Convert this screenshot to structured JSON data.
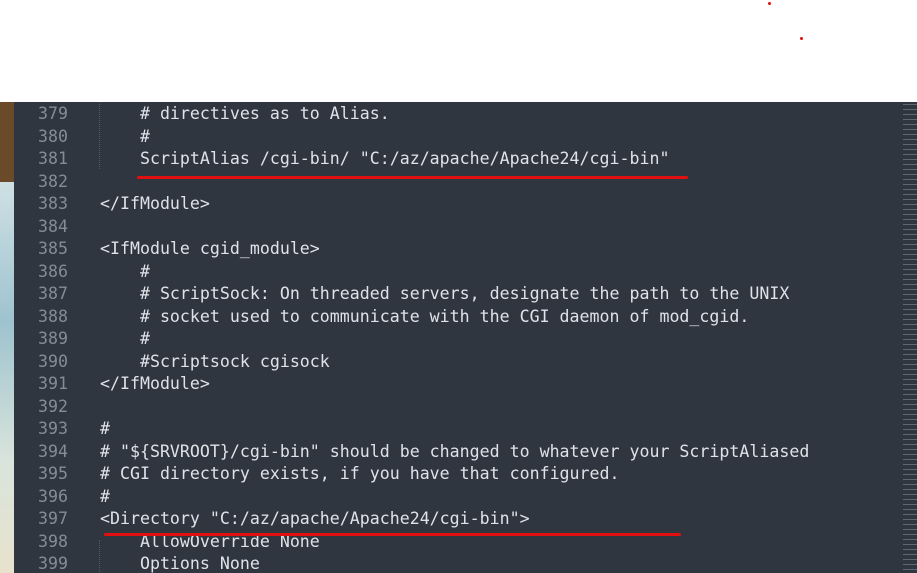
{
  "editor": {
    "lines": [
      {
        "n": "379",
        "text": "    # directives as to Alias."
      },
      {
        "n": "380",
        "text": "    #"
      },
      {
        "n": "381",
        "text": "    ScriptAlias /cgi-bin/ \"C:/az/apache/Apache24/cgi-bin\""
      },
      {
        "n": "382",
        "text": ""
      },
      {
        "n": "383",
        "text": "</IfModule>"
      },
      {
        "n": "384",
        "text": ""
      },
      {
        "n": "385",
        "text": "<IfModule cgid_module>"
      },
      {
        "n": "386",
        "text": "    #"
      },
      {
        "n": "387",
        "text": "    # ScriptSock: On threaded servers, designate the path to the UNIX"
      },
      {
        "n": "388",
        "text": "    # socket used to communicate with the CGI daemon of mod_cgid."
      },
      {
        "n": "389",
        "text": "    #"
      },
      {
        "n": "390",
        "text": "    #Scriptsock cgisock"
      },
      {
        "n": "391",
        "text": "</IfModule>"
      },
      {
        "n": "392",
        "text": ""
      },
      {
        "n": "393",
        "text": "#"
      },
      {
        "n": "394",
        "text": "# \"${SRVROOT}/cgi-bin\" should be changed to whatever your ScriptAliased"
      },
      {
        "n": "395",
        "text": "# CGI directory exists, if you have that configured."
      },
      {
        "n": "396",
        "text": "#"
      },
      {
        "n": "397",
        "text": "<Directory \"C:/az/apache/Apache24/cgi-bin\">"
      },
      {
        "n": "398",
        "text": "    AllowOverride None"
      },
      {
        "n": "399",
        "text": "    Options None"
      }
    ]
  },
  "colors": {
    "background": "#2f3640",
    "annotation": "#e01010",
    "text": "#dfe3e8",
    "gutter": "#858c94"
  }
}
